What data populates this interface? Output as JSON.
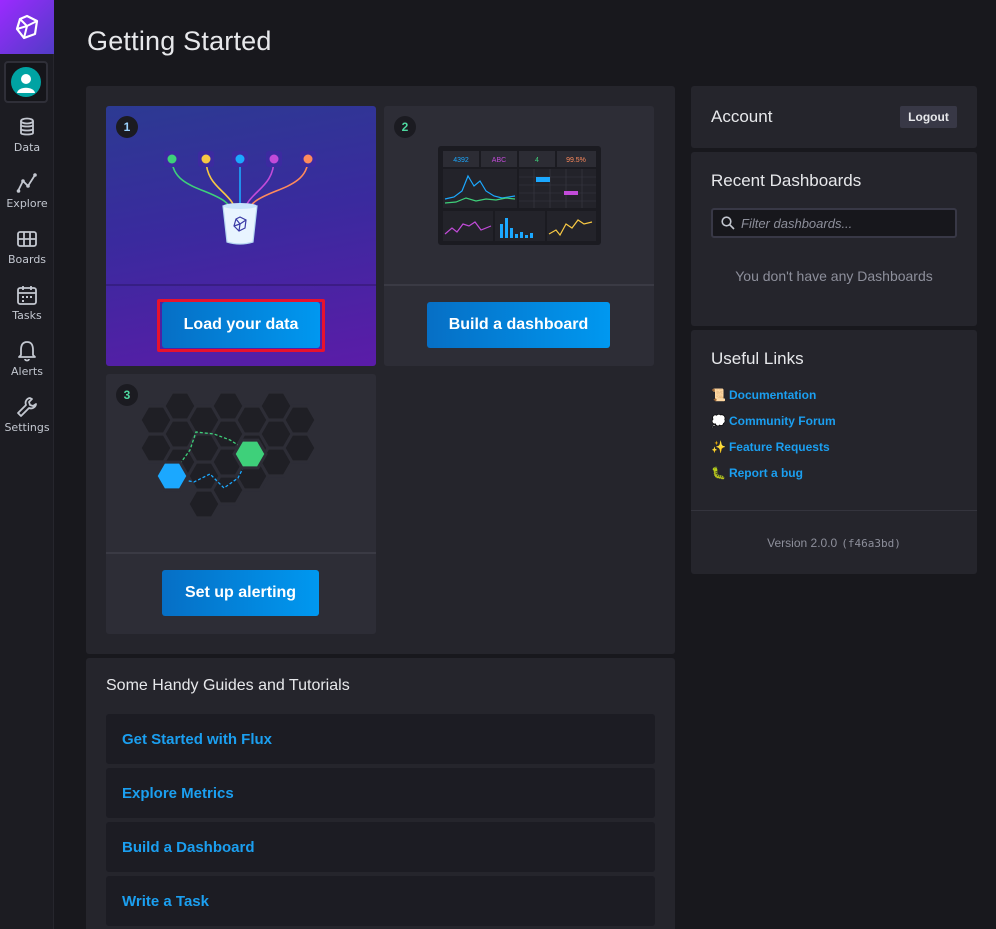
{
  "sidebar": {
    "items": [
      {
        "label": "Data",
        "icon": "database-icon"
      },
      {
        "label": "Explore",
        "icon": "graph-icon"
      },
      {
        "label": "Boards",
        "icon": "dashboard-grid-icon"
      },
      {
        "label": "Tasks",
        "icon": "calendar-icon"
      },
      {
        "label": "Alerts",
        "icon": "bell-icon"
      },
      {
        "label": "Settings",
        "icon": "wrench-icon"
      }
    ]
  },
  "header": {
    "title": "Getting Started"
  },
  "getting_started": {
    "cards": [
      {
        "step": "1",
        "button": "Load your data"
      },
      {
        "step": "2",
        "button": "Build a dashboard"
      },
      {
        "step": "3",
        "button": "Set up alerting"
      }
    ],
    "dashboard_preview": {
      "stat1": "4392",
      "stat2": "ABC",
      "stat3": "4",
      "stat4": "99.5%"
    }
  },
  "guides": {
    "title": "Some Handy Guides and Tutorials",
    "items": [
      "Get Started with Flux",
      "Explore Metrics",
      "Build a Dashboard",
      "Write a Task"
    ]
  },
  "account": {
    "title": "Account",
    "logout_label": "Logout"
  },
  "recent_dashboards": {
    "title": "Recent Dashboards",
    "filter_placeholder": "Filter dashboards...",
    "empty_text": "You don't have any Dashboards"
  },
  "useful_links": {
    "title": "Useful Links",
    "links": [
      {
        "emoji": "📜",
        "label": "Documentation"
      },
      {
        "emoji": "💭",
        "label": "Community Forum"
      },
      {
        "emoji": "✨",
        "label": "Feature Requests"
      },
      {
        "emoji": "🐛",
        "label": "Report a bug"
      }
    ],
    "version_label": "Version 2.0.0",
    "version_hash": "(f46a3bd)"
  },
  "colors": {
    "accent_blue": "#1b9ff0",
    "highlight_red": "#e8122d",
    "logo_purple": "#9b2aff"
  }
}
